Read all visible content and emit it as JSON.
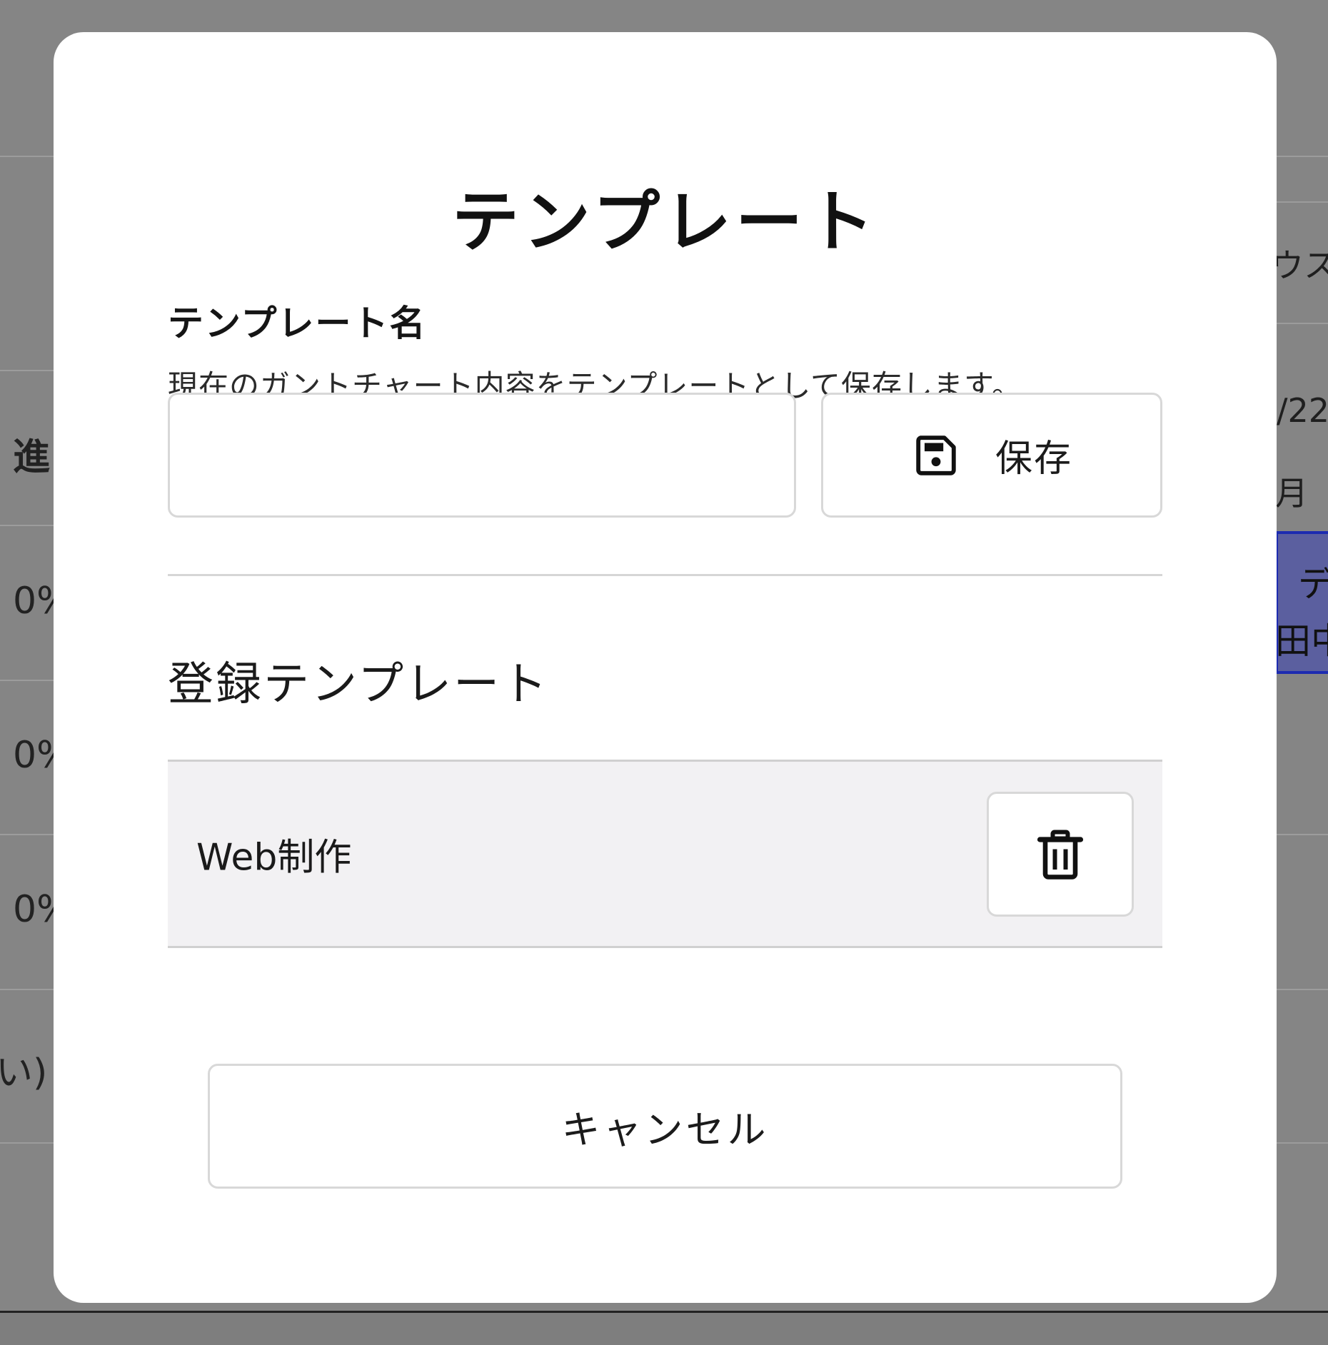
{
  "background": {
    "left_column": {
      "header": "進",
      "rows": [
        "0%",
        "0%",
        "0%",
        "い)"
      ]
    },
    "right_column": {
      "text_top": "ウス",
      "date": "/22",
      "day": "月",
      "task_line1": "デ",
      "task_line2": "田中"
    }
  },
  "modal": {
    "title": "テンプレート",
    "name_field": {
      "label": "テンプレート名",
      "description": "現在のガントチャート内容をテンプレートとして保存します。",
      "value": "",
      "placeholder": ""
    },
    "save_button": {
      "label": "保存",
      "icon": "save-icon"
    },
    "registered_section": {
      "title": "登録テンプレート",
      "items": [
        {
          "name": "Web制作",
          "delete_icon": "trash-icon"
        }
      ]
    },
    "cancel_button": {
      "label": "キャンセル"
    }
  },
  "colors": {
    "overlay": "#858585",
    "modal_bg": "#ffffff",
    "row_bg": "#f2f1f3",
    "border": "#d8d8d8",
    "task_bar": "#5b5f9f",
    "task_bar_border": "#1d2bb0"
  }
}
